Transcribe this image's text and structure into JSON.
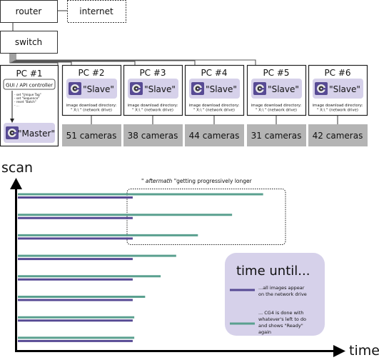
{
  "network": {
    "router": "router",
    "internet": "internet",
    "switch": "switch",
    "master_pc": {
      "title": "PC #1",
      "controller": "GUI / API controller",
      "commands": [
        "- set \"Unique Tag\"",
        "- set \"Sequence\"",
        "- reset \"Batch\"",
        "- ..."
      ],
      "role": "\"Master\"",
      "icon": "cg4-app-icon"
    },
    "slave_pcs": [
      {
        "title": "PC #2",
        "role": "\"Slave\"",
        "dir_line1": "image download directory:",
        "dir_line2": "\" X:\\ \"  (network drive)",
        "cameras": "51 cameras"
      },
      {
        "title": "PC #3",
        "role": "\"Slave\"",
        "dir_line1": "image download directory:",
        "dir_line2": "\" X:\\ \"  (network drive)",
        "cameras": "38 cameras"
      },
      {
        "title": "PC #4",
        "role": "\"Slave\"",
        "dir_line1": "image download directory:",
        "dir_line2": "\" X:\\ \"  (network drive)",
        "cameras": "44 cameras"
      },
      {
        "title": "PC #5",
        "role": "\"Slave\"",
        "dir_line1": "image download directory:",
        "dir_line2": "\" X:\\ \"  (network drive)",
        "cameras": "31 cameras"
      },
      {
        "title": "PC #6",
        "role": "\"Slave\"",
        "dir_line1": "image download directory:",
        "dir_line2": "\" X:\\ \"  (network drive)",
        "cameras": "42 cameras"
      }
    ]
  },
  "timeline": {
    "y_label": "scan",
    "x_label": "time",
    "annotation_prefix": "\" ",
    "annotation_italic": "aftermath",
    "annotation_suffix": " \"getting progressively longer",
    "legend": {
      "title": "time until...",
      "items": [
        {
          "text_lines": [
            "...all images appear",
            "on the network drive"
          ],
          "color": "#574a94"
        },
        {
          "text_lines": [
            "... CG4 is done with",
            "whatever's left to do",
            "and shows \"Ready\"",
            "again"
          ],
          "color": "#5aa08f"
        }
      ]
    },
    "scans_relative_time": [
      {
        "images_on_drive": 0.37,
        "cg4_ready": 0.79
      },
      {
        "images_on_drive": 0.37,
        "cg4_ready": 0.69
      },
      {
        "images_on_drive": 0.37,
        "cg4_ready": 0.58
      },
      {
        "images_on_drive": 0.37,
        "cg4_ready": 0.51
      },
      {
        "images_on_drive": 0.37,
        "cg4_ready": 0.46
      },
      {
        "images_on_drive": 0.37,
        "cg4_ready": 0.41
      },
      {
        "images_on_drive": 0.37,
        "cg4_ready": 0.375
      },
      {
        "images_on_drive": 0.37,
        "cg4_ready": 0.375
      }
    ]
  },
  "colors": {
    "role_box": "#d6d1ea",
    "camera_box": "#b4b4b4",
    "icon_bg": "#574a94",
    "purple_bar": "#574a94",
    "green_bar": "#5aa08f"
  }
}
